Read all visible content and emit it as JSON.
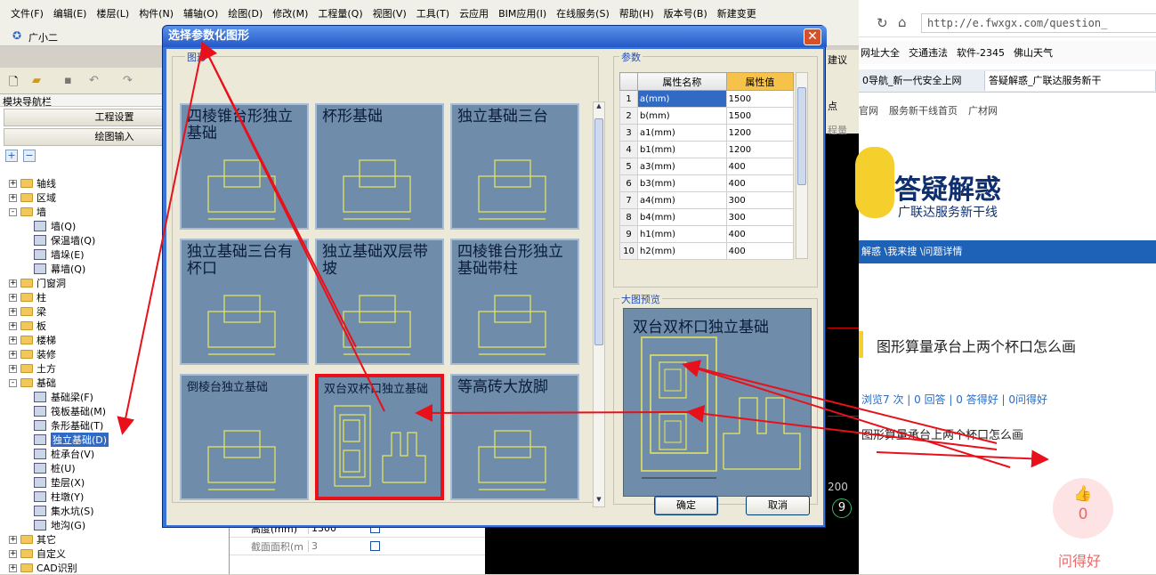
{
  "app": {
    "menu": [
      "文件(F)",
      "编辑(E)",
      "楼层(L)",
      "构件(N)",
      "辅轴(O)",
      "绘图(D)",
      "修改(M)",
      "工程量(Q)",
      "视图(V)",
      "工具(T)",
      "云应用",
      "BIM应用(I)",
      "在线服务(S)",
      "帮助(H)",
      "版本号(B)",
      "新建变更"
    ],
    "assistant": "广小二",
    "right_toolbar_label": "建议",
    "right_toolbar_label2": "点",
    "right_toolbar_label3": "程量",
    "canvas_number": "200",
    "canvas_circle": "9"
  },
  "nav": {
    "title": "模块导航栏",
    "buttons": [
      "工程设置",
      "绘图输入"
    ],
    "tree": [
      {
        "label": "轴线",
        "level": 0,
        "exp": "+",
        "type": "folder"
      },
      {
        "label": "区域",
        "level": 0,
        "exp": "+",
        "type": "folder"
      },
      {
        "label": "墙",
        "level": 0,
        "exp": "-",
        "type": "folder"
      },
      {
        "label": "墙(Q)",
        "level": 1,
        "type": "item"
      },
      {
        "label": "保温墙(Q)",
        "level": 1,
        "type": "item"
      },
      {
        "label": "墙垛(E)",
        "level": 1,
        "type": "item"
      },
      {
        "label": "幕墙(Q)",
        "level": 1,
        "type": "item"
      },
      {
        "label": "门窗洞",
        "level": 0,
        "exp": "+",
        "type": "folder"
      },
      {
        "label": "柱",
        "level": 0,
        "exp": "+",
        "type": "folder"
      },
      {
        "label": "梁",
        "level": 0,
        "exp": "+",
        "type": "folder"
      },
      {
        "label": "板",
        "level": 0,
        "exp": "+",
        "type": "folder"
      },
      {
        "label": "楼梯",
        "level": 0,
        "exp": "+",
        "type": "folder"
      },
      {
        "label": "装修",
        "level": 0,
        "exp": "+",
        "type": "folder"
      },
      {
        "label": "土方",
        "level": 0,
        "exp": "+",
        "type": "folder"
      },
      {
        "label": "基础",
        "level": 0,
        "exp": "-",
        "type": "folder"
      },
      {
        "label": "基础梁(F)",
        "level": 1,
        "type": "item"
      },
      {
        "label": "筏板基础(M)",
        "level": 1,
        "type": "item"
      },
      {
        "label": "条形基础(T)",
        "level": 1,
        "type": "item"
      },
      {
        "label": "独立基础(D)",
        "level": 1,
        "type": "item",
        "selected": true
      },
      {
        "label": "桩承台(V)",
        "level": 1,
        "type": "item"
      },
      {
        "label": "桩(U)",
        "level": 1,
        "type": "item"
      },
      {
        "label": "垫层(X)",
        "level": 1,
        "type": "item"
      },
      {
        "label": "柱墩(Y)",
        "level": 1,
        "type": "item"
      },
      {
        "label": "集水坑(S)",
        "level": 1,
        "type": "item"
      },
      {
        "label": "地沟(G)",
        "level": 1,
        "type": "item"
      },
      {
        "label": "其它",
        "level": 0,
        "exp": "+",
        "type": "folder"
      },
      {
        "label": "自定义",
        "level": 0,
        "exp": "+",
        "type": "folder"
      },
      {
        "label": "CAD识别",
        "level": 0,
        "exp": "+",
        "type": "folder"
      }
    ]
  },
  "props": [
    {
      "name": "高度(mm)",
      "value": "1300"
    },
    {
      "name": "截面面积(m",
      "value": "3"
    }
  ],
  "dialog": {
    "title": "选择参数化图形",
    "graph_group": "图形",
    "params_group": "参数",
    "preview_group": "大图预览",
    "ok": "确定",
    "cancel": "取消",
    "tiles": [
      {
        "title": "四棱锥台形独立基础",
        "small": false
      },
      {
        "title": "杯形基础",
        "small": false
      },
      {
        "title": "独立基础三台",
        "small": false
      },
      {
        "title": "独立基础三台有杯口",
        "small": false
      },
      {
        "title": "独立基础双层带坡",
        "small": false
      },
      {
        "title": "四棱锥台形独立基础带柱",
        "small": false
      },
      {
        "title": "倒棱台独立基础",
        "small": true
      },
      {
        "title": "双台双杯口独立基础",
        "small": true,
        "selected": true
      },
      {
        "title": "等高砖大放脚",
        "small": false
      }
    ],
    "param_headers": [
      "属性名称",
      "属性值"
    ],
    "params": [
      {
        "n": "1",
        "k": "a(mm)",
        "v": "1500"
      },
      {
        "n": "2",
        "k": "b(mm)",
        "v": "1500"
      },
      {
        "n": "3",
        "k": "a1(mm)",
        "v": "1200"
      },
      {
        "n": "4",
        "k": "b1(mm)",
        "v": "1200"
      },
      {
        "n": "5",
        "k": "a3(mm)",
        "v": "400"
      },
      {
        "n": "6",
        "k": "b3(mm)",
        "v": "400"
      },
      {
        "n": "7",
        "k": "a4(mm)",
        "v": "300"
      },
      {
        "n": "8",
        "k": "b4(mm)",
        "v": "300"
      },
      {
        "n": "9",
        "k": "h1(mm)",
        "v": "400"
      },
      {
        "n": "10",
        "k": "h2(mm)",
        "v": "400"
      }
    ],
    "preview_title": "双台双杯口独立基础"
  },
  "browser": {
    "address": "http://e.fwxgx.com/question_",
    "favorites": [
      "网址大全",
      "交通违法",
      "软件-2345",
      "佛山天气"
    ],
    "tabs": [
      "0导航_新一代安全上网",
      "答疑解惑_广联达服务新干"
    ],
    "nav_links": [
      "官网",
      "服务新干线首页",
      "广材网"
    ],
    "banner_title": "答疑解惑",
    "banner_sub": "广联达服务新干线",
    "breadcrumb": "解惑 \\我来搜 \\问题详情",
    "question_title": "图形算量承台上两个杯口怎么画",
    "stats": "浏览7 次 | 0 回答 | 0 答得好 | 0问得好",
    "question_body": "图形算量承台上两个杯口怎么画",
    "like_count": "0",
    "like_label": "问得好"
  },
  "colors": {
    "annotation_arrow": "#e8101a",
    "selection": "#316ac5",
    "dialog_title": "#2458c8"
  }
}
